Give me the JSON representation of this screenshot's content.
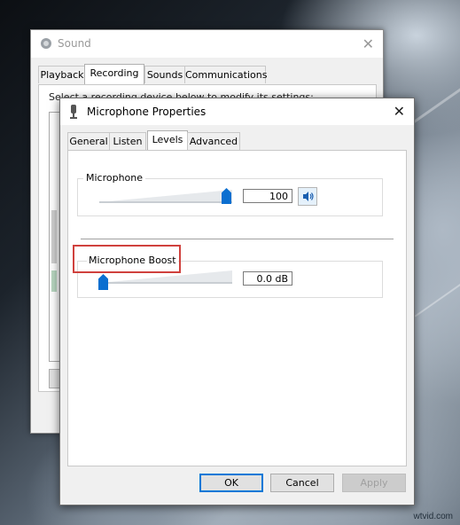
{
  "sound_window": {
    "title": "Sound",
    "tabs": [
      "Playback",
      "Recording",
      "Sounds",
      "Communications"
    ],
    "active_tab": "Recording",
    "panel_text": "Select a recording device below to modify its settings:"
  },
  "mic_dialog": {
    "title": "Microphone Properties",
    "tabs": [
      "General",
      "Listen",
      "Levels",
      "Advanced"
    ],
    "active_tab": "Levels",
    "microphone": {
      "label": "Microphone",
      "value": "100",
      "level_fraction": 1.0
    },
    "boost": {
      "label": "Microphone Boost",
      "value": "0.0 dB",
      "level_fraction": 0.0
    },
    "buttons": {
      "ok": "OK",
      "cancel": "Cancel",
      "apply": "Apply"
    }
  },
  "icons": {
    "sound_window_icon": "speaker-icon",
    "mic_window_icon": "microphone-icon",
    "speaker_button_icon": "speaker-volume-icon",
    "close": "close-icon"
  },
  "colors": {
    "accent": "#0078d7",
    "slider_thumb": "#0b6fd0",
    "highlight": "#d0413d"
  },
  "watermark": "wtvid.com"
}
